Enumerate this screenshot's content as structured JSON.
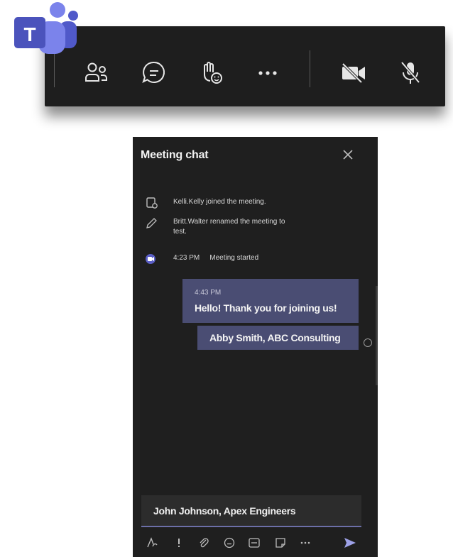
{
  "app": {
    "logo_letter": "T"
  },
  "toolbar": {
    "buttons": [
      {
        "name": "people",
        "icon": "people-icon"
      },
      {
        "name": "chat",
        "icon": "chat-icon"
      },
      {
        "name": "reactions",
        "icon": "raise-hand-icon"
      },
      {
        "name": "more",
        "icon": "more-icon"
      },
      {
        "name": "camera",
        "icon": "camera-off-icon"
      },
      {
        "name": "mic",
        "icon": "mic-off-icon"
      }
    ]
  },
  "chat": {
    "title": "Meeting chat",
    "events": [
      {
        "icon": "join-icon",
        "text": "Kelli.Kelly joined the meeting."
      },
      {
        "icon": "pencil-icon",
        "text": "Britt.Walter renamed the meeting to test."
      },
      {
        "icon": "video-icon",
        "time": "4:23 PM",
        "text": "Meeting started"
      }
    ],
    "messages": [
      {
        "time": "4:43 PM",
        "text": "Hello! Thank you for joining us!"
      },
      {
        "text": "Abby Smith, ABC Consulting"
      }
    ],
    "compose": {
      "value": "John Johnson, Apex Engineers"
    },
    "compose_tools": [
      "format-icon",
      "important-icon",
      "attach-icon",
      "emoji-icon",
      "gif-icon",
      "sticker-icon",
      "more-icon"
    ],
    "colors": {
      "bubble": "#4a4d73",
      "panel": "#1f1f1f",
      "accent": "#6c6fa8"
    }
  }
}
